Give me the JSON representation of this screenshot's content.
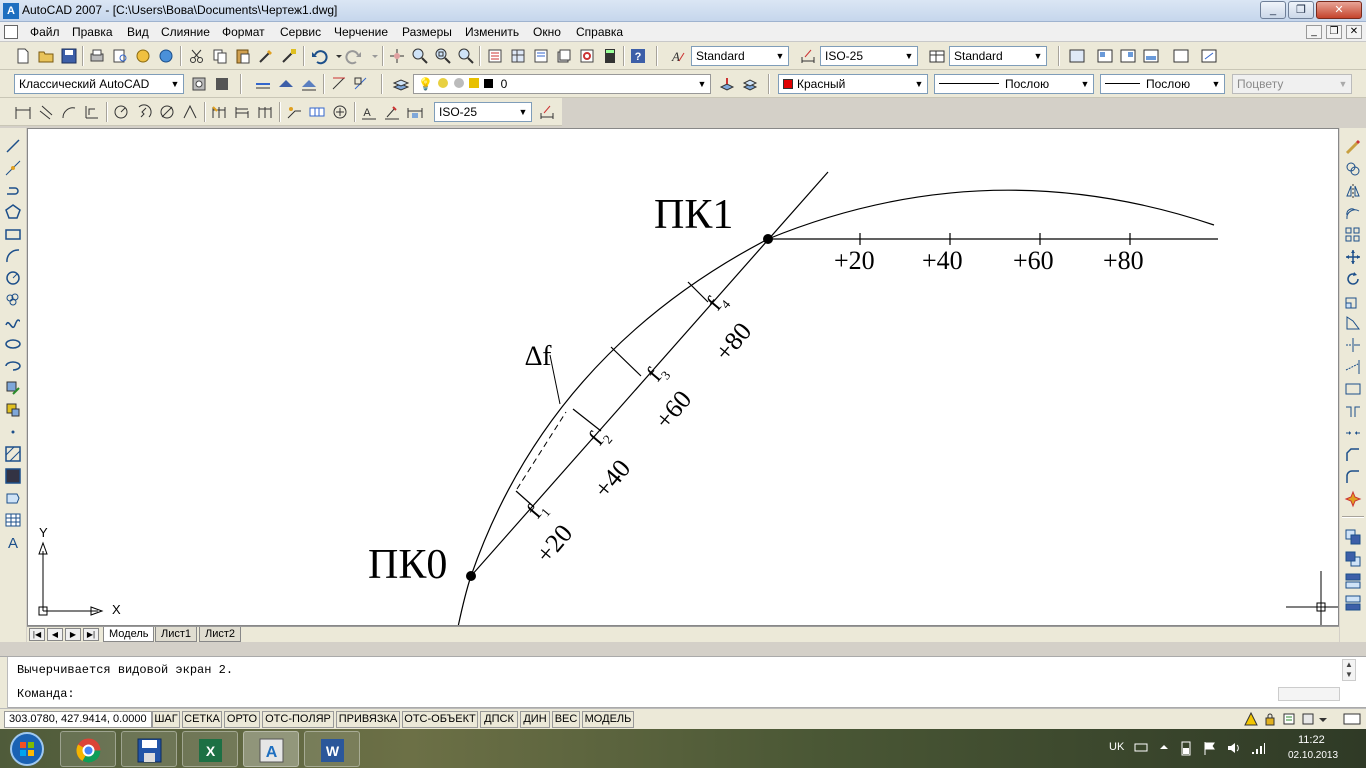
{
  "window": {
    "title": "AutoCAD 2007 - [C:\\Users\\Вова\\Documents\\Чертеж1.dwg]",
    "controls": {
      "minimize": "_",
      "restore": "❐",
      "close": "✕"
    }
  },
  "menu": {
    "items": [
      "Файл",
      "Правка",
      "Вид",
      "Слияние",
      "Формат",
      "Сервис",
      "Черчение",
      "Размеры",
      "Изменить",
      "Окно",
      "Справка"
    ]
  },
  "toolbar_standard": {
    "text_style_combo": "Standard",
    "dim_style_combo": "ISO-25",
    "table_style_combo": "Standard"
  },
  "toolbar_layers": {
    "workspace_combo": "Классический AutoCAD",
    "layer_combo": "0",
    "color_combo": "Красный",
    "color_hex": "#e00000",
    "linetype_combo": "Послою",
    "lineweight_combo": "Послою",
    "plotstyle_combo": "Поцвету"
  },
  "toolbar_dimension": {
    "dim_style_combo": "ISO-25"
  },
  "drawing": {
    "label_pk0": "ПК0",
    "label_pk1": "ПК1",
    "station_labels_tangent": [
      "+20",
      "+40",
      "+60",
      "+80"
    ],
    "offset_labels": [
      "f",
      "f",
      "f",
      "f"
    ],
    "offset_subscripts": [
      "1",
      "2",
      "3",
      "4"
    ],
    "station_labels_line": [
      "+20",
      "+40",
      "+60",
      "+80"
    ],
    "delta_label": "∆f",
    "ucs_x": "X",
    "ucs_y": "Y"
  },
  "layout_tabs": [
    "Модель",
    "Лист1",
    "Лист2"
  ],
  "command": {
    "history": "Вычерчивается видовой экран 2.",
    "prompt": "Команда:"
  },
  "status": {
    "coords": "303.0780, 427.9414, 0.0000",
    "toggles": [
      "ШАГ",
      "СЕТКА",
      "ОРТО",
      "ОТС-ПОЛЯР",
      "ПРИВЯЗКА",
      "ОТС-ОБЪЕКТ",
      "ДПСК",
      "ДИН",
      "ВЕС",
      "МОДЕЛЬ"
    ]
  },
  "taskbar": {
    "lang": "UK",
    "time": "11:22",
    "date": "02.10.2013"
  }
}
